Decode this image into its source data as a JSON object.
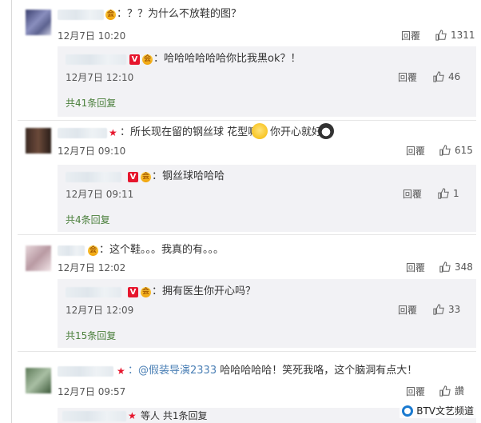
{
  "comments": [
    {
      "text": "：？？为什么不放鞋的图？",
      "time": "12月7日 10:20",
      "reply_label": "回覆",
      "likes": "1311",
      "reply": {
        "text": "：哈哈哈哈哈哈你比我黑ok？！",
        "time": "12月7日 12:10",
        "reply_label": "回覆",
        "likes": "46"
      },
      "more": "共41条回复"
    },
    {
      "text": "：所长现在留的钢丝球 花型嘛",
      "text_tail": "你开心就好",
      "time": "12月7日 09:10",
      "reply_label": "回覆",
      "likes": "615",
      "reply": {
        "text": "：钢丝球哈哈哈",
        "time": "12月7日 09:11",
        "reply_label": "回覆",
        "likes": "1"
      },
      "more": "共4条回复"
    },
    {
      "text": "：这个鞋。。。我真的有。。。",
      "time": "12月7日 12:02",
      "reply_label": "回覆",
      "likes": "348",
      "reply": {
        "text": "：拥有医生你开心吗？",
        "time": "12月7日 12:09",
        "reply_label": "回覆",
        "likes": "33"
      },
      "more": "共15条回复"
    },
    {
      "mention": "：@假装导演2333",
      "text": " 哈哈哈哈哈！笑死我咯，这个脑洞有点大！",
      "time": "12月7日 09:57",
      "reply_label": "回覆",
      "likes": "讚",
      "reply_preview": "等人 共1条回复"
    }
  ],
  "watermark": "BTV文艺频道",
  "colors": {
    "link_green": "#4a7f3b",
    "mention_blue": "#4a7fb5",
    "vip_red": "#e6162d",
    "reply_bg": "#f2f2f5"
  }
}
